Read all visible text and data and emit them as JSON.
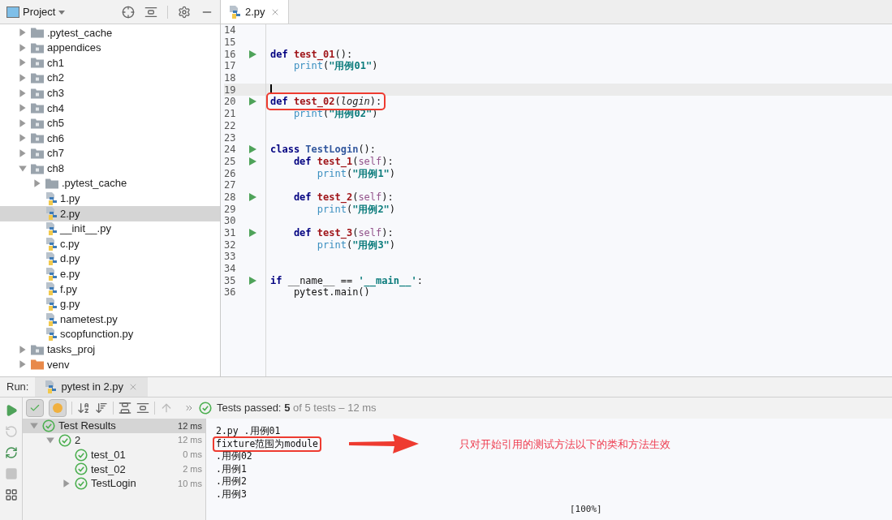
{
  "project_panel": {
    "title": "Project",
    "tree": [
      {
        "label": ".pytest_cache",
        "kind": "folder",
        "expanded": false,
        "selected": false
      },
      {
        "label": "appendices",
        "kind": "module",
        "expanded": false,
        "selected": false
      },
      {
        "label": "ch1",
        "kind": "module",
        "expanded": false,
        "selected": false
      },
      {
        "label": "ch2",
        "kind": "module",
        "expanded": false,
        "selected": false
      },
      {
        "label": "ch3",
        "kind": "module",
        "expanded": false,
        "selected": false
      },
      {
        "label": "ch4",
        "kind": "module",
        "expanded": false,
        "selected": false
      },
      {
        "label": "ch5",
        "kind": "module",
        "expanded": false,
        "selected": false
      },
      {
        "label": "ch6",
        "kind": "module",
        "expanded": false,
        "selected": false
      },
      {
        "label": "ch7",
        "kind": "module",
        "expanded": false,
        "selected": false
      },
      {
        "label": "ch8",
        "kind": "module",
        "expanded": true,
        "selected": false,
        "children": [
          {
            "label": ".pytest_cache",
            "kind": "folder",
            "expanded": false,
            "selected": false
          },
          {
            "label": "1.py",
            "kind": "file",
            "selected": false
          },
          {
            "label": "2.py",
            "kind": "file",
            "selected": true
          },
          {
            "label": "__init__.py",
            "kind": "file",
            "selected": false
          },
          {
            "label": "c.py",
            "kind": "file",
            "selected": false
          },
          {
            "label": "d.py",
            "kind": "file",
            "selected": false
          },
          {
            "label": "e.py",
            "kind": "file",
            "selected": false
          },
          {
            "label": "f.py",
            "kind": "file",
            "selected": false
          },
          {
            "label": "g.py",
            "kind": "file",
            "selected": false
          },
          {
            "label": "nametest.py",
            "kind": "file",
            "selected": false
          },
          {
            "label": "scopfunction.py",
            "kind": "file",
            "selected": false
          }
        ]
      },
      {
        "label": "tasks_proj",
        "kind": "module",
        "expanded": false,
        "selected": false
      },
      {
        "label": "venv",
        "kind": "excluded",
        "expanded": false,
        "selected": false
      }
    ]
  },
  "editor": {
    "tabs": [
      {
        "label": "2.py",
        "selected": true
      }
    ],
    "lines": [
      {
        "number": "14",
        "runnable": false,
        "current": false
      },
      {
        "number": "15",
        "runnable": false,
        "current": false
      },
      {
        "number": "16",
        "runnable": true,
        "current": false,
        "boxed": false,
        "tokens": [
          {
            "text": "def ",
            "kind": "keyword"
          },
          {
            "text": "test_01",
            "kind": "function"
          },
          {
            "text": "():",
            "kind": "plain"
          }
        ]
      },
      {
        "number": "17",
        "runnable": false,
        "current": false,
        "boxed": false,
        "tokens": [
          {
            "text": "    print",
            "kind": "builtin"
          },
          {
            "text": "(",
            "kind": "plain"
          },
          {
            "text": "\"用例01\"",
            "kind": "string"
          },
          {
            "text": ")",
            "kind": "plain"
          }
        ]
      },
      {
        "number": "18",
        "runnable": false,
        "current": false
      },
      {
        "number": "19",
        "runnable": false,
        "current": true
      },
      {
        "number": "20",
        "runnable": true,
        "current": false,
        "boxed": true,
        "tokens": [
          {
            "text": "def ",
            "kind": "keyword"
          },
          {
            "text": "test_02",
            "kind": "function"
          },
          {
            "text": "(",
            "kind": "plain"
          },
          {
            "text": "login",
            "kind": "param"
          },
          {
            "text": "):",
            "kind": "plain"
          }
        ]
      },
      {
        "number": "21",
        "runnable": false,
        "current": false,
        "boxed": false,
        "tokens": [
          {
            "text": "    print",
            "kind": "builtin"
          },
          {
            "text": "(",
            "kind": "plain"
          },
          {
            "text": "\"用例02\"",
            "kind": "string"
          },
          {
            "text": ")",
            "kind": "plain"
          }
        ]
      },
      {
        "number": "22",
        "runnable": false,
        "current": false
      },
      {
        "number": "23",
        "runnable": false,
        "current": false
      },
      {
        "number": "24",
        "runnable": true,
        "current": false,
        "boxed": false,
        "tokens": [
          {
            "text": "class ",
            "kind": "keyword"
          },
          {
            "text": "TestLogin",
            "kind": "class"
          },
          {
            "text": "():",
            "kind": "plain"
          }
        ]
      },
      {
        "number": "25",
        "runnable": true,
        "current": false,
        "boxed": false,
        "tokens": [
          {
            "text": "    def ",
            "kind": "keyword"
          },
          {
            "text": "test_1",
            "kind": "function"
          },
          {
            "text": "(",
            "kind": "plain"
          },
          {
            "text": "self",
            "kind": "self"
          },
          {
            "text": "):",
            "kind": "plain"
          }
        ]
      },
      {
        "number": "26",
        "runnable": false,
        "current": false,
        "boxed": false,
        "tokens": [
          {
            "text": "        print",
            "kind": "builtin"
          },
          {
            "text": "(",
            "kind": "plain"
          },
          {
            "text": "\"用例1\"",
            "kind": "string"
          },
          {
            "text": ")",
            "kind": "plain"
          }
        ]
      },
      {
        "number": "27",
        "runnable": false,
        "current": false
      },
      {
        "number": "28",
        "runnable": true,
        "current": false,
        "boxed": false,
        "tokens": [
          {
            "text": "    def ",
            "kind": "keyword"
          },
          {
            "text": "test_2",
            "kind": "function"
          },
          {
            "text": "(",
            "kind": "plain"
          },
          {
            "text": "self",
            "kind": "self"
          },
          {
            "text": "):",
            "kind": "plain"
          }
        ]
      },
      {
        "number": "29",
        "runnable": false,
        "current": false,
        "boxed": false,
        "tokens": [
          {
            "text": "        print",
            "kind": "builtin"
          },
          {
            "text": "(",
            "kind": "plain"
          },
          {
            "text": "\"用例2\"",
            "kind": "string"
          },
          {
            "text": ")",
            "kind": "plain"
          }
        ]
      },
      {
        "number": "30",
        "runnable": false,
        "current": false
      },
      {
        "number": "31",
        "runnable": true,
        "current": false,
        "boxed": false,
        "tokens": [
          {
            "text": "    def ",
            "kind": "keyword"
          },
          {
            "text": "test_3",
            "kind": "function"
          },
          {
            "text": "(",
            "kind": "plain"
          },
          {
            "text": "self",
            "kind": "self"
          },
          {
            "text": "):",
            "kind": "plain"
          }
        ]
      },
      {
        "number": "32",
        "runnable": false,
        "current": false,
        "boxed": false,
        "tokens": [
          {
            "text": "        print",
            "kind": "builtin"
          },
          {
            "text": "(",
            "kind": "plain"
          },
          {
            "text": "\"用例3\"",
            "kind": "string"
          },
          {
            "text": ")",
            "kind": "plain"
          }
        ]
      },
      {
        "number": "33",
        "runnable": false,
        "current": false
      },
      {
        "number": "34",
        "runnable": false,
        "current": false
      },
      {
        "number": "35",
        "runnable": true,
        "current": false,
        "boxed": false,
        "tokens": [
          {
            "text": "if ",
            "kind": "keyword"
          },
          {
            "text": "__name__ == ",
            "kind": "plain"
          },
          {
            "text": "'__main__'",
            "kind": "string"
          },
          {
            "text": ":",
            "kind": "plain"
          }
        ]
      },
      {
        "number": "36",
        "runnable": false,
        "current": false,
        "boxed": false,
        "tokens": [
          {
            "text": "    pytest.main()",
            "kind": "plain"
          }
        ]
      }
    ]
  },
  "run_panel": {
    "title": "Run:",
    "tabs": [
      {
        "label": "pytest in 2.py",
        "selected": true
      }
    ],
    "toggles": [
      {
        "selected": true
      },
      {
        "selected": true
      }
    ],
    "status": {
      "label": "Tests passed:",
      "count": "5",
      "detail": "of 5 tests – 12 ms"
    },
    "results": [
      {
        "label": "Test Results",
        "time": "12 ms",
        "expanded": true,
        "selected": true,
        "children": [
          {
            "label": "2",
            "time": "12 ms",
            "expanded": true,
            "selected": false,
            "children": [
              {
                "label": "test_01",
                "time": "0 ms",
                "selected": false
              },
              {
                "label": "test_02",
                "time": "2 ms",
                "selected": false
              },
              {
                "label": "TestLogin",
                "time": "10 ms",
                "expanded": false,
                "selected": false
              }
            ]
          }
        ]
      }
    ],
    "console": [
      {
        "text": "2.py .用例01",
        "boxed": false
      },
      {
        "text": "fixture范围为module",
        "boxed": true
      },
      {
        "text": ".用例02",
        "boxed": false
      },
      {
        "text": ".用例1",
        "boxed": false
      },
      {
        "text": ".用例2",
        "boxed": false
      },
      {
        "text": ".用例3",
        "boxed": false
      }
    ],
    "progress": "[100%]"
  },
  "annotation": {
    "note": "只对开始引用的测试方法以下的类和方法生效"
  }
}
